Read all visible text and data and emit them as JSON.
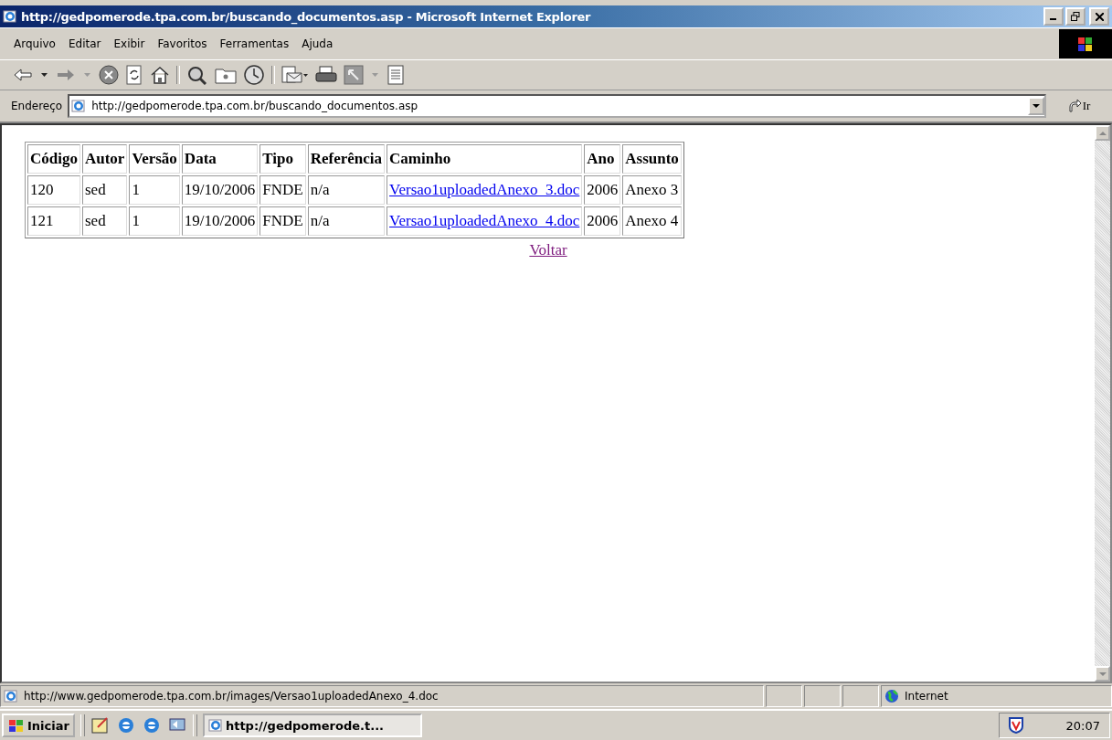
{
  "window": {
    "title": "http://gedpomerode.tpa.com.br/buscando_documentos.asp - Microsoft Internet Explorer"
  },
  "menu": [
    "Arquivo",
    "Editar",
    "Exibir",
    "Favoritos",
    "Ferramentas",
    "Ajuda"
  ],
  "address_bar": {
    "label": "Endereço",
    "value": "http://gedpomerode.tpa.com.br/buscando_documentos.asp",
    "go_label": "Ir"
  },
  "table": {
    "columns": [
      {
        "label": "Código",
        "kind": "text"
      },
      {
        "label": "Autor",
        "kind": "text"
      },
      {
        "label": "Versão",
        "kind": "text"
      },
      {
        "label": "Data",
        "kind": "text"
      },
      {
        "label": "Tipo",
        "kind": "text"
      },
      {
        "label": "Referência",
        "kind": "text"
      },
      {
        "label": "Caminho",
        "kind": "link"
      },
      {
        "label": "Ano",
        "kind": "text"
      },
      {
        "label": "Assunto",
        "kind": "text"
      }
    ],
    "rows": [
      {
        "cells": [
          "120",
          "sed",
          "1",
          "19/10/2006",
          "FNDE",
          "n/a",
          "Versao1uploadedAnexo_3.doc",
          "2006",
          "Anexo 3"
        ]
      },
      {
        "cells": [
          "121",
          "sed",
          "1",
          "19/10/2006",
          "FNDE",
          "n/a",
          "Versao1uploadedAnexo_4.doc",
          "2006",
          "Anexo 4"
        ]
      }
    ]
  },
  "back_link": {
    "label": "Voltar",
    "visited": true
  },
  "status_bar": {
    "text": "http://www.gedpomerode.tpa.com.br/images/Versao1uploadedAnexo_4.doc",
    "zone": "Internet"
  },
  "taskbar": {
    "start": "Iniciar",
    "windows": [
      {
        "label": "http://gedpomerode.t...",
        "selected": true
      }
    ],
    "clock": "20:07"
  }
}
